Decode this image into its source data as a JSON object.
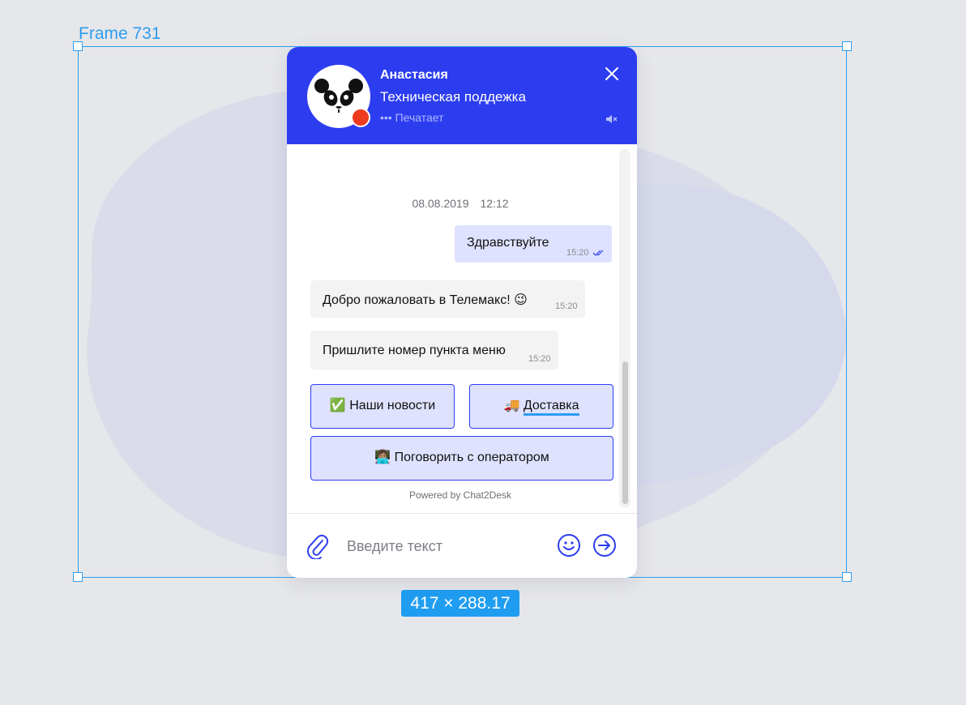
{
  "frame": {
    "label": "Frame 731",
    "dimensions": "417 × 288.17"
  },
  "header": {
    "agent_name": "Анастасия",
    "agent_role": "Техническая поддежка",
    "typing_status": "••• Печатает",
    "close_icon": "close-icon",
    "mute_icon": "mute-icon"
  },
  "conversation": {
    "date": "08.08.2019",
    "time": "12:12",
    "messages": [
      {
        "direction": "outgoing",
        "text": "Здравствуйте",
        "time": "15:20",
        "status": "read"
      },
      {
        "direction": "incoming",
        "text": "Добро пожаловать в Телемакс! 😉",
        "time": "15:20"
      },
      {
        "direction": "incoming",
        "text": "Пришлите номер пункта меню",
        "time": "15:20"
      }
    ]
  },
  "quick_replies": [
    {
      "icon": "✅",
      "label": "Наши новости"
    },
    {
      "icon": "🚚",
      "label": "Доставка"
    },
    {
      "icon": "👩🏽‍💻",
      "label": "Поговорить с оператором"
    }
  ],
  "powered_by": "Powered by Chat2Desk",
  "composer": {
    "placeholder": "Введите текст",
    "attach_icon": "paperclip-icon",
    "emoji_icon": "smiley-icon",
    "send_icon": "send-arrow-icon"
  },
  "colors": {
    "accent": "#2C3DF0",
    "outgoing_bubble": "#DFE2FE",
    "incoming_bubble": "#F3F3F4",
    "selection": "#2D9CF0",
    "status_dot": "#EE3B1F"
  }
}
